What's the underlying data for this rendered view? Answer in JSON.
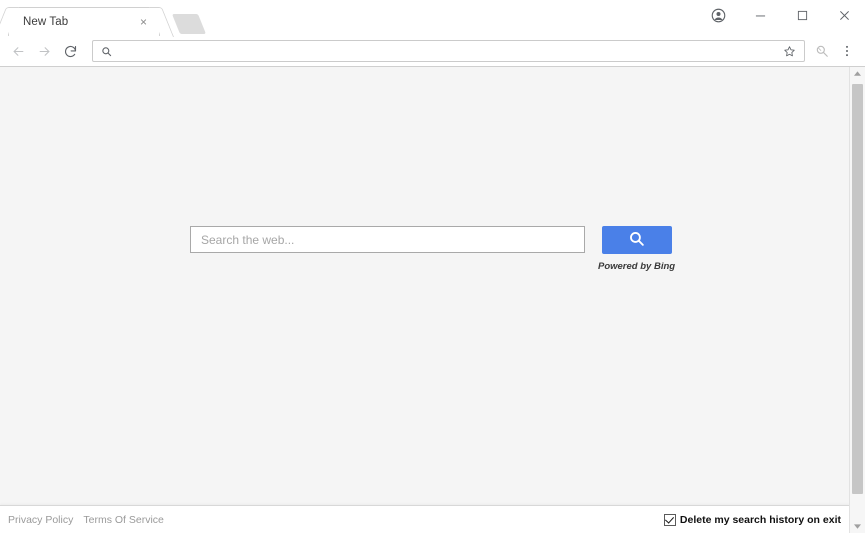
{
  "window": {
    "controls": {
      "profile": "profile-avatar",
      "minimize": "–",
      "maximize": "□",
      "close": "×"
    }
  },
  "tabs": [
    {
      "title": "New Tab",
      "close_label": "×"
    }
  ],
  "new_tab_button": {
    "label": ""
  },
  "toolbar": {
    "back": "back-arrow",
    "forward": "forward-arrow",
    "reload": "reload-arrow",
    "omnibox": {
      "value": "",
      "placeholder": ""
    },
    "star": "bookmark-star",
    "extension": "extension-icon",
    "menu": "three-dot-menu"
  },
  "page": {
    "search": {
      "input_value": "",
      "placeholder": "Search the web...",
      "button_icon": "search-icon",
      "powered_by": "Powered by Bing"
    },
    "footer": {
      "links": [
        {
          "label": "Privacy Policy"
        },
        {
          "label": "Terms Of Service"
        }
      ],
      "checkbox": {
        "label": "Delete my search history on exit",
        "checked": true
      }
    }
  },
  "colors": {
    "accent_blue": "#4a80e8",
    "page_background": "#f5f5f5",
    "chrome_background": "#ffffff",
    "scrollbar_thumb": "#c6c6c6"
  }
}
